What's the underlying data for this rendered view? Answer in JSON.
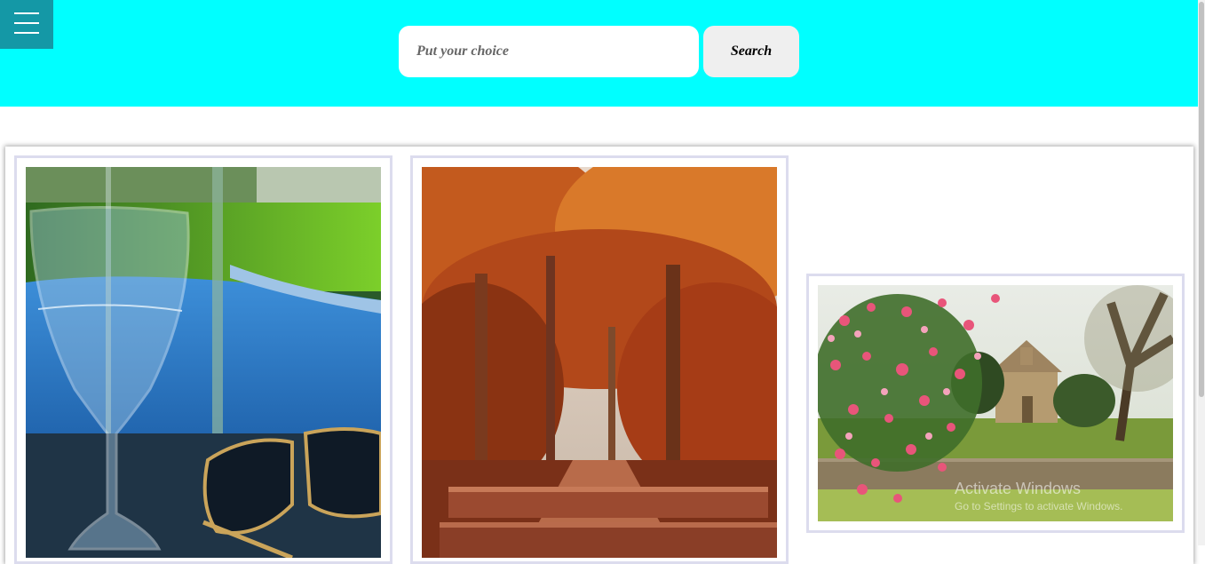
{
  "header": {
    "menu_icon": "hamburger-menu-icon",
    "background_color": "#00ffff",
    "menu_color": "#1498a6"
  },
  "search": {
    "placeholder": "Put your choice",
    "value": "",
    "button_label": "Search"
  },
  "gallery": {
    "images": [
      {
        "subject": "water glass and sunglasses by a pool"
      },
      {
        "subject": "autumn trees over stone steps"
      },
      {
        "subject": "pink blossom tree beside a stone church"
      }
    ]
  },
  "overlay": {
    "watermark_line1": "Activate Windows",
    "watermark_line2": "Go to Settings to activate Windows."
  }
}
